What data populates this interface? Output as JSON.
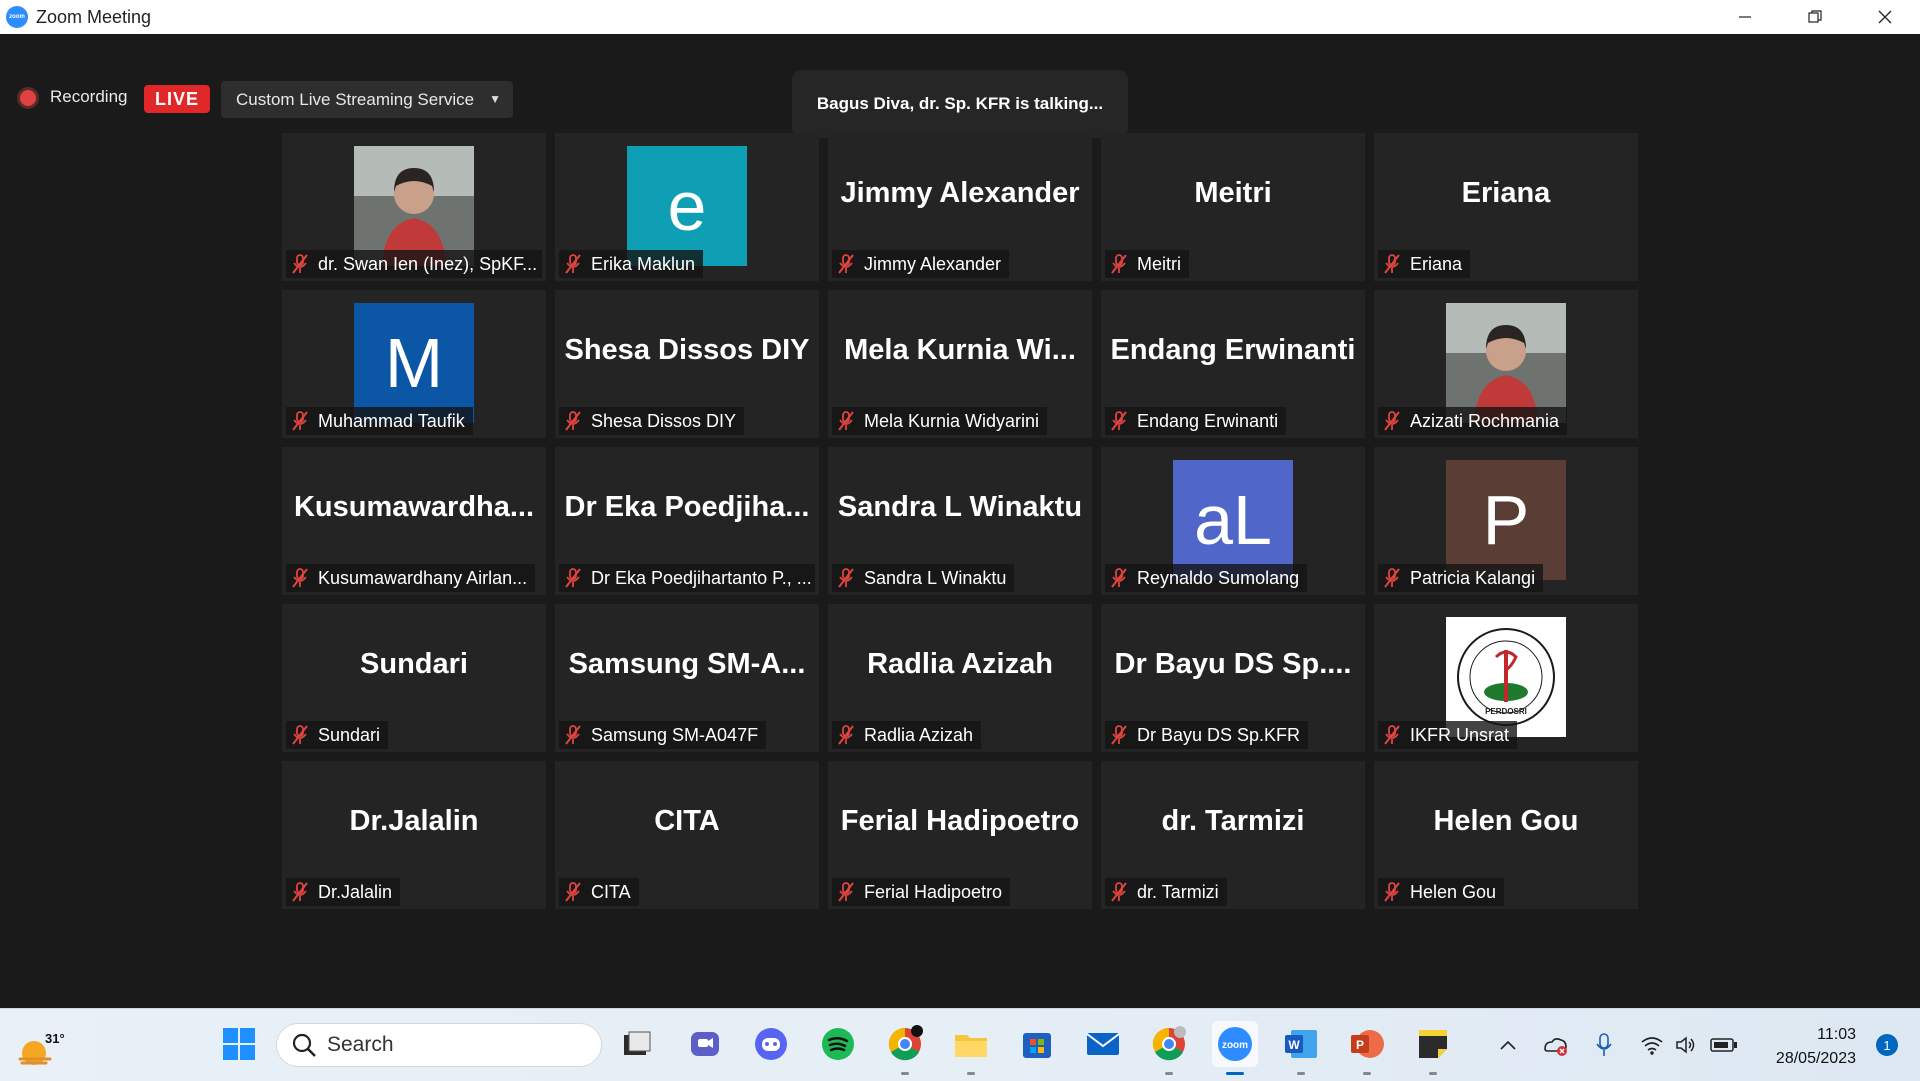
{
  "window": {
    "title": "Zoom Meeting"
  },
  "meeting": {
    "recording_label": "Recording",
    "live_label": "LIVE",
    "stream_service": "Custom Live Streaming Service",
    "talking_banner": "Bagus Diva, dr. Sp. KFR is talking..."
  },
  "participants": [
    {
      "display": "",
      "label": "dr. Swan Ien (Inez), SpKF...",
      "avatar": "photo",
      "avatar_color": ""
    },
    {
      "display": "e",
      "label": "Erika Maklun",
      "avatar": "letter",
      "avatar_color": "#0e9fb5"
    },
    {
      "display": "Jimmy Alexander",
      "label": "Jimmy Alexander",
      "avatar": "none",
      "avatar_color": ""
    },
    {
      "display": "Meitri",
      "label": "Meitri",
      "avatar": "none",
      "avatar_color": ""
    },
    {
      "display": "Eriana",
      "label": "Eriana",
      "avatar": "none",
      "avatar_color": ""
    },
    {
      "display": "M",
      "label": "Muhammad Taufik",
      "avatar": "letter",
      "avatar_color": "#0c56a6"
    },
    {
      "display": "Shesa Dissos DIY",
      "label": "Shesa Dissos DIY",
      "avatar": "none",
      "avatar_color": ""
    },
    {
      "display": "Mela Kurnia Wi...",
      "label": "Mela Kurnia Widyarini",
      "avatar": "none",
      "avatar_color": ""
    },
    {
      "display": "Endang Erwinanti",
      "label": "Endang Erwinanti",
      "avatar": "none",
      "avatar_color": ""
    },
    {
      "display": "",
      "label": "Azizati Rochmania",
      "avatar": "photo",
      "avatar_color": ""
    },
    {
      "display": "Kusumawardha...",
      "label": "Kusumawardhany Airlan...",
      "avatar": "none",
      "avatar_color": ""
    },
    {
      "display": "Dr Eka Poedjiha...",
      "label": "Dr Eka Poedjihartanto P., ...",
      "avatar": "none",
      "avatar_color": ""
    },
    {
      "display": "Sandra L Winaktu",
      "label": "Sandra L Winaktu",
      "avatar": "none",
      "avatar_color": ""
    },
    {
      "display": "aL",
      "label": "Reynaldo Sumolang",
      "avatar": "letter",
      "avatar_color": "#5066c8"
    },
    {
      "display": "P",
      "label": "Patricia Kalangi",
      "avatar": "letter",
      "avatar_color": "#5a3d34"
    },
    {
      "display": "Sundari",
      "label": "Sundari",
      "avatar": "none",
      "avatar_color": ""
    },
    {
      "display": "Samsung  SM-A...",
      "label": "Samsung SM-A047F",
      "avatar": "none",
      "avatar_color": ""
    },
    {
      "display": "Radlia Azizah",
      "label": "Radlia Azizah",
      "avatar": "none",
      "avatar_color": ""
    },
    {
      "display": "Dr Bayu DS Sp....",
      "label": "Dr Bayu DS Sp.KFR",
      "avatar": "none",
      "avatar_color": ""
    },
    {
      "display": "",
      "label": "IKFR Unsrat",
      "avatar": "logo",
      "avatar_color": "",
      "logo_text": "PERDOSRI"
    },
    {
      "display": "Dr.Jalalin",
      "label": "Dr.Jalalin",
      "avatar": "none",
      "avatar_color": ""
    },
    {
      "display": "CITA",
      "label": "CITA",
      "avatar": "none",
      "avatar_color": ""
    },
    {
      "display": "Ferial Hadipoetro",
      "label": "Ferial Hadipoetro",
      "avatar": "none",
      "avatar_color": ""
    },
    {
      "display": "dr. Tarmizi",
      "label": "dr. Tarmizi",
      "avatar": "none",
      "avatar_color": ""
    },
    {
      "display": "Helen Gou",
      "label": "Helen Gou",
      "avatar": "none",
      "avatar_color": ""
    }
  ],
  "taskbar": {
    "weather_temp": "31°",
    "search_placeholder": "Search",
    "apps": [
      "start-icon",
      "task-view-icon",
      "teams-icon",
      "discord-icon",
      "spotify-icon",
      "chrome-icon",
      "file-explorer-icon",
      "microsoft-store-icon",
      "mail-icon",
      "chrome-profile-icon",
      "zoom-icon",
      "word-icon",
      "powerpoint-icon",
      "sticky-notes-icon"
    ],
    "time": "11:03",
    "date": "28/05/2023",
    "notification_count": "1"
  }
}
